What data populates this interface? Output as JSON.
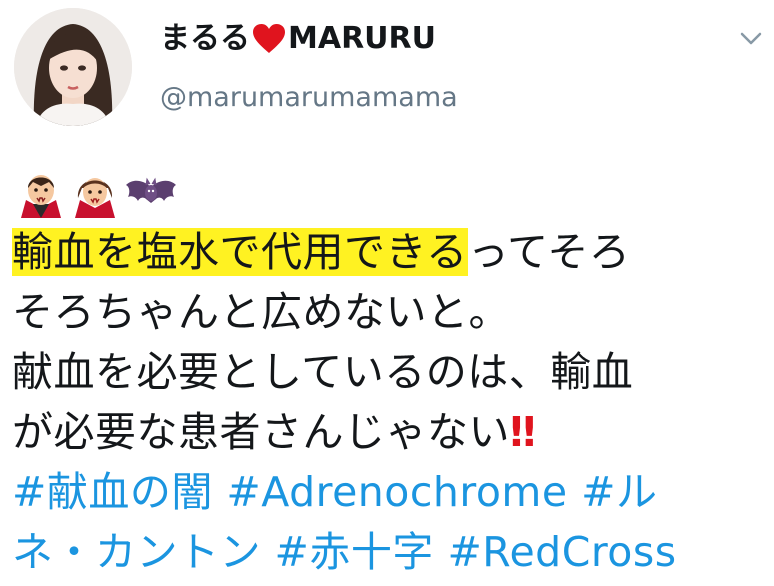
{
  "profile": {
    "display_name_left": "まるる",
    "display_name_right": "MARURU",
    "handle": "@marumarumamama",
    "heart_icon": "red-heart-icon",
    "avatar_icon": "profile-avatar-icon"
  },
  "menu": {
    "caret_icon": "chevron-down-icon"
  },
  "emoji": [
    "man-vampire-icon",
    "woman-vampire-icon",
    "bat-icon"
  ],
  "tweet": {
    "l1_highlight": "輸血を塩水で代用できる",
    "l1_rest": "ってそろ",
    "l2": "そろちゃんと広めないと。",
    "l3": "献血を必要としているのは、輸血",
    "l4": "が必要な患者さんじゃない",
    "l4_emoji": "‼",
    "hashtags": [
      "#献血の闇",
      "#Adrenochrome",
      "#ル",
      "ネ・カントン",
      "#赤十字",
      "#RedCross"
    ]
  },
  "colors": {
    "text": "#14171a",
    "secondary": "#657786",
    "link": "#1b95e0",
    "highlight": "#fff222",
    "heart": "#e0141e"
  }
}
